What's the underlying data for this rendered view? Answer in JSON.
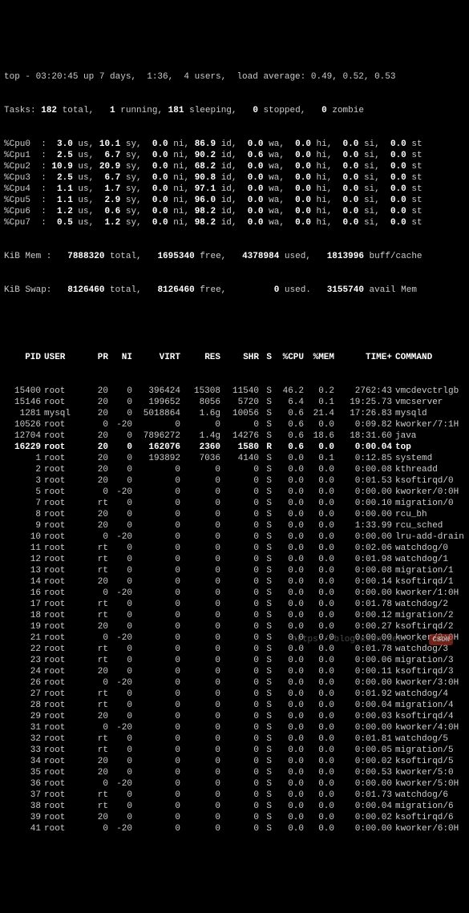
{
  "top_line": "top - 03:20:45 up 7 days,  1:36,  4 users,  load average: 0.49, 0.52, 0.53",
  "tasks": {
    "total": "182",
    "running": "1",
    "sleeping": "181",
    "stopped": "0",
    "zombie": "0"
  },
  "cpus": [
    {
      "label": "%Cpu0",
      "us": "3.0",
      "sy": "10.1",
      "ni": "0.0",
      "id": "86.9",
      "wa": "0.0",
      "hi": "0.0",
      "si": "0.0",
      "st": "0.0"
    },
    {
      "label": "%Cpu1",
      "us": "2.5",
      "sy": "6.7",
      "ni": "0.0",
      "id": "90.2",
      "wa": "0.6",
      "hi": "0.0",
      "si": "0.0",
      "st": "0.0"
    },
    {
      "label": "%Cpu2",
      "us": "10.9",
      "sy": "20.9",
      "ni": "0.0",
      "id": "68.2",
      "wa": "0.0",
      "hi": "0.0",
      "si": "0.0",
      "st": "0.0"
    },
    {
      "label": "%Cpu3",
      "us": "2.5",
      "sy": "6.7",
      "ni": "0.0",
      "id": "90.8",
      "wa": "0.0",
      "hi": "0.0",
      "si": "0.0",
      "st": "0.0"
    },
    {
      "label": "%Cpu4",
      "us": "1.1",
      "sy": "1.7",
      "ni": "0.0",
      "id": "97.1",
      "wa": "0.0",
      "hi": "0.0",
      "si": "0.0",
      "st": "0.0"
    },
    {
      "label": "%Cpu5",
      "us": "1.1",
      "sy": "2.9",
      "ni": "0.0",
      "id": "96.0",
      "wa": "0.0",
      "hi": "0.0",
      "si": "0.0",
      "st": "0.0"
    },
    {
      "label": "%Cpu6",
      "us": "1.2",
      "sy": "0.6",
      "ni": "0.0",
      "id": "98.2",
      "wa": "0.0",
      "hi": "0.0",
      "si": "0.0",
      "st": "0.0"
    },
    {
      "label": "%Cpu7",
      "us": "0.5",
      "sy": "1.2",
      "ni": "0.0",
      "id": "98.2",
      "wa": "0.0",
      "hi": "0.0",
      "si": "0.0",
      "st": "0.0"
    }
  ],
  "mem": {
    "label": "KiB Mem :",
    "total": "7888320",
    "free": "1695340",
    "used": "4378984",
    "buff": "1813996"
  },
  "swap": {
    "label": "KiB Swap:",
    "total": "8126460",
    "free": "8126460",
    "used": "0",
    "avail": "3155740"
  },
  "columns": {
    "pid": "PID",
    "user": "USER",
    "pr": "PR",
    "ni": "NI",
    "virt": "VIRT",
    "res": "RES",
    "shr": "SHR",
    "s": "S",
    "cpu": "%CPU",
    "mem": "%MEM",
    "time": "TIME+",
    "cmd": "COMMAND"
  },
  "highlighted_row": 5,
  "processes": [
    {
      "pid": "15400",
      "user": "root",
      "pr": "20",
      "ni": "0",
      "virt": "396424",
      "res": "15308",
      "shr": "11540",
      "s": "S",
      "cpu": "46.2",
      "mem": "0.2",
      "time": "2762:43",
      "cmd": "vmcdevctrlgb"
    },
    {
      "pid": "15146",
      "user": "root",
      "pr": "20",
      "ni": "0",
      "virt": "199652",
      "res": "8056",
      "shr": "5720",
      "s": "S",
      "cpu": "6.4",
      "mem": "0.1",
      "time": "19:25.73",
      "cmd": "vmcserver"
    },
    {
      "pid": "1281",
      "user": "mysql",
      "pr": "20",
      "ni": "0",
      "virt": "5018864",
      "res": "1.6g",
      "shr": "10056",
      "s": "S",
      "cpu": "0.6",
      "mem": "21.4",
      "time": "17:26.83",
      "cmd": "mysqld"
    },
    {
      "pid": "10526",
      "user": "root",
      "pr": "0",
      "ni": "-20",
      "virt": "0",
      "res": "0",
      "shr": "0",
      "s": "S",
      "cpu": "0.6",
      "mem": "0.0",
      "time": "0:09.82",
      "cmd": "kworker/7:1H"
    },
    {
      "pid": "12704",
      "user": "root",
      "pr": "20",
      "ni": "0",
      "virt": "7896272",
      "res": "1.4g",
      "shr": "14276",
      "s": "S",
      "cpu": "0.6",
      "mem": "18.6",
      "time": "18:31.60",
      "cmd": "java"
    },
    {
      "pid": "16229",
      "user": "root",
      "pr": "20",
      "ni": "0",
      "virt": "162076",
      "res": "2360",
      "shr": "1580",
      "s": "R",
      "cpu": "0.6",
      "mem": "0.0",
      "time": "0:00.04",
      "cmd": "top"
    },
    {
      "pid": "1",
      "user": "root",
      "pr": "20",
      "ni": "0",
      "virt": "193892",
      "res": "7036",
      "shr": "4140",
      "s": "S",
      "cpu": "0.0",
      "mem": "0.1",
      "time": "0:12.85",
      "cmd": "systemd"
    },
    {
      "pid": "2",
      "user": "root",
      "pr": "20",
      "ni": "0",
      "virt": "0",
      "res": "0",
      "shr": "0",
      "s": "S",
      "cpu": "0.0",
      "mem": "0.0",
      "time": "0:00.08",
      "cmd": "kthreadd"
    },
    {
      "pid": "3",
      "user": "root",
      "pr": "20",
      "ni": "0",
      "virt": "0",
      "res": "0",
      "shr": "0",
      "s": "S",
      "cpu": "0.0",
      "mem": "0.0",
      "time": "0:01.53",
      "cmd": "ksoftirqd/0"
    },
    {
      "pid": "5",
      "user": "root",
      "pr": "0",
      "ni": "-20",
      "virt": "0",
      "res": "0",
      "shr": "0",
      "s": "S",
      "cpu": "0.0",
      "mem": "0.0",
      "time": "0:00.00",
      "cmd": "kworker/0:0H"
    },
    {
      "pid": "7",
      "user": "root",
      "pr": "rt",
      "ni": "0",
      "virt": "0",
      "res": "0",
      "shr": "0",
      "s": "S",
      "cpu": "0.0",
      "mem": "0.0",
      "time": "0:00.10",
      "cmd": "migration/0"
    },
    {
      "pid": "8",
      "user": "root",
      "pr": "20",
      "ni": "0",
      "virt": "0",
      "res": "0",
      "shr": "0",
      "s": "S",
      "cpu": "0.0",
      "mem": "0.0",
      "time": "0:00.00",
      "cmd": "rcu_bh"
    },
    {
      "pid": "9",
      "user": "root",
      "pr": "20",
      "ni": "0",
      "virt": "0",
      "res": "0",
      "shr": "0",
      "s": "S",
      "cpu": "0.0",
      "mem": "0.0",
      "time": "1:33.99",
      "cmd": "rcu_sched"
    },
    {
      "pid": "10",
      "user": "root",
      "pr": "0",
      "ni": "-20",
      "virt": "0",
      "res": "0",
      "shr": "0",
      "s": "S",
      "cpu": "0.0",
      "mem": "0.0",
      "time": "0:00.00",
      "cmd": "lru-add-drain"
    },
    {
      "pid": "11",
      "user": "root",
      "pr": "rt",
      "ni": "0",
      "virt": "0",
      "res": "0",
      "shr": "0",
      "s": "S",
      "cpu": "0.0",
      "mem": "0.0",
      "time": "0:02.06",
      "cmd": "watchdog/0"
    },
    {
      "pid": "12",
      "user": "root",
      "pr": "rt",
      "ni": "0",
      "virt": "0",
      "res": "0",
      "shr": "0",
      "s": "S",
      "cpu": "0.0",
      "mem": "0.0",
      "time": "0:01.98",
      "cmd": "watchdog/1"
    },
    {
      "pid": "13",
      "user": "root",
      "pr": "rt",
      "ni": "0",
      "virt": "0",
      "res": "0",
      "shr": "0",
      "s": "S",
      "cpu": "0.0",
      "mem": "0.0",
      "time": "0:00.08",
      "cmd": "migration/1"
    },
    {
      "pid": "14",
      "user": "root",
      "pr": "20",
      "ni": "0",
      "virt": "0",
      "res": "0",
      "shr": "0",
      "s": "S",
      "cpu": "0.0",
      "mem": "0.0",
      "time": "0:00.14",
      "cmd": "ksoftirqd/1"
    },
    {
      "pid": "16",
      "user": "root",
      "pr": "0",
      "ni": "-20",
      "virt": "0",
      "res": "0",
      "shr": "0",
      "s": "S",
      "cpu": "0.0",
      "mem": "0.0",
      "time": "0:00.00",
      "cmd": "kworker/1:0H"
    },
    {
      "pid": "17",
      "user": "root",
      "pr": "rt",
      "ni": "0",
      "virt": "0",
      "res": "0",
      "shr": "0",
      "s": "S",
      "cpu": "0.0",
      "mem": "0.0",
      "time": "0:01.78",
      "cmd": "watchdog/2"
    },
    {
      "pid": "18",
      "user": "root",
      "pr": "rt",
      "ni": "0",
      "virt": "0",
      "res": "0",
      "shr": "0",
      "s": "S",
      "cpu": "0.0",
      "mem": "0.0",
      "time": "0:00.12",
      "cmd": "migration/2"
    },
    {
      "pid": "19",
      "user": "root",
      "pr": "20",
      "ni": "0",
      "virt": "0",
      "res": "0",
      "shr": "0",
      "s": "S",
      "cpu": "0.0",
      "mem": "0.0",
      "time": "0:00.27",
      "cmd": "ksoftirqd/2"
    },
    {
      "pid": "21",
      "user": "root",
      "pr": "0",
      "ni": "-20",
      "virt": "0",
      "res": "0",
      "shr": "0",
      "s": "S",
      "cpu": "0.0",
      "mem": "0.0",
      "time": "0:00.00",
      "cmd": "kworker/2:0H"
    },
    {
      "pid": "22",
      "user": "root",
      "pr": "rt",
      "ni": "0",
      "virt": "0",
      "res": "0",
      "shr": "0",
      "s": "S",
      "cpu": "0.0",
      "mem": "0.0",
      "time": "0:01.78",
      "cmd": "watchdog/3"
    },
    {
      "pid": "23",
      "user": "root",
      "pr": "rt",
      "ni": "0",
      "virt": "0",
      "res": "0",
      "shr": "0",
      "s": "S",
      "cpu": "0.0",
      "mem": "0.0",
      "time": "0:00.06",
      "cmd": "migration/3"
    },
    {
      "pid": "24",
      "user": "root",
      "pr": "20",
      "ni": "0",
      "virt": "0",
      "res": "0",
      "shr": "0",
      "s": "S",
      "cpu": "0.0",
      "mem": "0.0",
      "time": "0:00.11",
      "cmd": "ksoftirqd/3"
    },
    {
      "pid": "26",
      "user": "root",
      "pr": "0",
      "ni": "-20",
      "virt": "0",
      "res": "0",
      "shr": "0",
      "s": "S",
      "cpu": "0.0",
      "mem": "0.0",
      "time": "0:00.00",
      "cmd": "kworker/3:0H"
    },
    {
      "pid": "27",
      "user": "root",
      "pr": "rt",
      "ni": "0",
      "virt": "0",
      "res": "0",
      "shr": "0",
      "s": "S",
      "cpu": "0.0",
      "mem": "0.0",
      "time": "0:01.92",
      "cmd": "watchdog/4"
    },
    {
      "pid": "28",
      "user": "root",
      "pr": "rt",
      "ni": "0",
      "virt": "0",
      "res": "0",
      "shr": "0",
      "s": "S",
      "cpu": "0.0",
      "mem": "0.0",
      "time": "0:00.04",
      "cmd": "migration/4"
    },
    {
      "pid": "29",
      "user": "root",
      "pr": "20",
      "ni": "0",
      "virt": "0",
      "res": "0",
      "shr": "0",
      "s": "S",
      "cpu": "0.0",
      "mem": "0.0",
      "time": "0:00.03",
      "cmd": "ksoftirqd/4"
    },
    {
      "pid": "31",
      "user": "root",
      "pr": "0",
      "ni": "-20",
      "virt": "0",
      "res": "0",
      "shr": "0",
      "s": "S",
      "cpu": "0.0",
      "mem": "0.0",
      "time": "0:00.00",
      "cmd": "kworker/4:0H"
    },
    {
      "pid": "32",
      "user": "root",
      "pr": "rt",
      "ni": "0",
      "virt": "0",
      "res": "0",
      "shr": "0",
      "s": "S",
      "cpu": "0.0",
      "mem": "0.0",
      "time": "0:01.81",
      "cmd": "watchdog/5"
    },
    {
      "pid": "33",
      "user": "root",
      "pr": "rt",
      "ni": "0",
      "virt": "0",
      "res": "0",
      "shr": "0",
      "s": "S",
      "cpu": "0.0",
      "mem": "0.0",
      "time": "0:00.05",
      "cmd": "migration/5"
    },
    {
      "pid": "34",
      "user": "root",
      "pr": "20",
      "ni": "0",
      "virt": "0",
      "res": "0",
      "shr": "0",
      "s": "S",
      "cpu": "0.0",
      "mem": "0.0",
      "time": "0:00.02",
      "cmd": "ksoftirqd/5"
    },
    {
      "pid": "35",
      "user": "root",
      "pr": "20",
      "ni": "0",
      "virt": "0",
      "res": "0",
      "shr": "0",
      "s": "S",
      "cpu": "0.0",
      "mem": "0.0",
      "time": "0:00.53",
      "cmd": "kworker/5:0"
    },
    {
      "pid": "36",
      "user": "root",
      "pr": "0",
      "ni": "-20",
      "virt": "0",
      "res": "0",
      "shr": "0",
      "s": "S",
      "cpu": "0.0",
      "mem": "0.0",
      "time": "0:00.00",
      "cmd": "kworker/5:0H"
    },
    {
      "pid": "37",
      "user": "root",
      "pr": "rt",
      "ni": "0",
      "virt": "0",
      "res": "0",
      "shr": "0",
      "s": "S",
      "cpu": "0.0",
      "mem": "0.0",
      "time": "0:01.73",
      "cmd": "watchdog/6"
    },
    {
      "pid": "38",
      "user": "root",
      "pr": "rt",
      "ni": "0",
      "virt": "0",
      "res": "0",
      "shr": "0",
      "s": "S",
      "cpu": "0.0",
      "mem": "0.0",
      "time": "0:00.04",
      "cmd": "migration/6"
    },
    {
      "pid": "39",
      "user": "root",
      "pr": "20",
      "ni": "0",
      "virt": "0",
      "res": "0",
      "shr": "0",
      "s": "S",
      "cpu": "0.0",
      "mem": "0.0",
      "time": "0:00.02",
      "cmd": "ksoftirqd/6"
    },
    {
      "pid": "41",
      "user": "root",
      "pr": "0",
      "ni": "-20",
      "virt": "0",
      "res": "0",
      "shr": "0",
      "s": "S",
      "cpu": "0.0",
      "mem": "0.0",
      "time": "0:00.00",
      "cmd": "kworker/6:0H"
    }
  ],
  "watermark": "https://blog.csdn.net/..."
}
